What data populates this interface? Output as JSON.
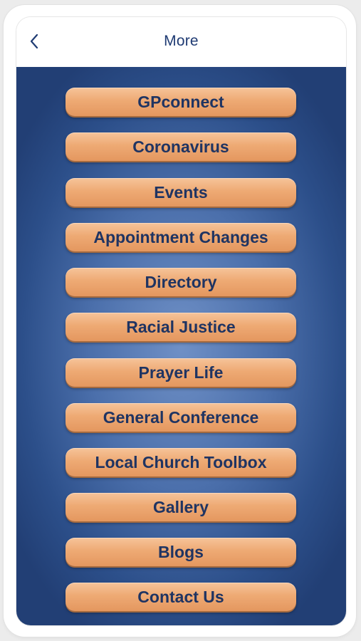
{
  "header": {
    "title": "More",
    "back_icon": "chevron-left-icon"
  },
  "colors": {
    "accent": "#1f3b73",
    "background_blue": "#2c4f8a",
    "button_orange": "#eeaa74",
    "button_text": "#1f3462"
  },
  "menu": {
    "items": [
      {
        "label": "GPconnect"
      },
      {
        "label": "Coronavirus"
      },
      {
        "label": "Events"
      },
      {
        "label": "Appointment Changes"
      },
      {
        "label": "Directory"
      },
      {
        "label": "Racial Justice"
      },
      {
        "label": "Prayer Life"
      },
      {
        "label": "General Conference"
      },
      {
        "label": "Local Church Toolbox"
      },
      {
        "label": "Gallery"
      },
      {
        "label": "Blogs"
      },
      {
        "label": "Contact Us"
      }
    ]
  }
}
